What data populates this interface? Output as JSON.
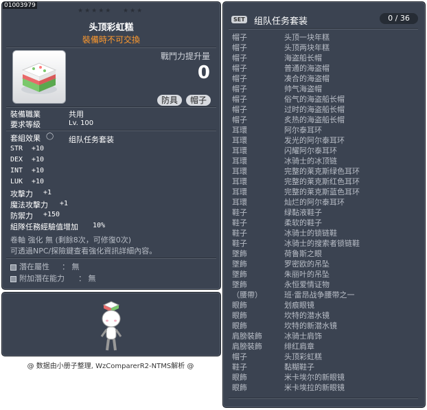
{
  "item": {
    "code": "01003979",
    "stars_left": "★★★★★",
    "stars_right": "★★★",
    "name": "头顶彩虹糕",
    "trade_note": "裝備時不可交換",
    "combat_label": "戰鬥力提升量",
    "combat_value": "0",
    "tags": [
      "防具",
      "帽子"
    ],
    "job_label": "裝備職業",
    "job_value": "共用",
    "level_label": "要求等級",
    "level_value": "Lv. 100",
    "set_effect_label": "套組效果",
    "set_effect_value": "组队任务套装",
    "stats": [
      {
        "name": "STR",
        "value": "+10"
      },
      {
        "name": "DEX",
        "value": "+10"
      },
      {
        "name": "INT",
        "value": "+10"
      },
      {
        "name": "LUK",
        "value": "+10"
      },
      {
        "name": "攻擊力",
        "value": "+1"
      },
      {
        "name": "魔法攻擊力",
        "value": "+1"
      },
      {
        "name": "防禦力",
        "value": "+150"
      },
      {
        "name": "組隊任務經驗值增加",
        "value": "10%"
      }
    ],
    "scroll_line": "卷軸 強化 無 (剩餘8次，可修復0次)",
    "hint_line": "可透過NPC/探險鍵查看強化資訊詳細內容。",
    "potential_label": "潛在屬性",
    "potential_value": "： 無",
    "bonus_potential_label": "附加潛在能力",
    "bonus_potential_value": "： 無"
  },
  "credit": "@ 数据由小册子整理, WzComparerR2-NTMS解析 @",
  "set": {
    "badge": "SET",
    "title": "组队任务套装",
    "counter": "0 / 36",
    "items": [
      {
        "cat": "帽子",
        "name": "头顶一块年糕"
      },
      {
        "cat": "帽子",
        "name": "头顶两块年糕"
      },
      {
        "cat": "帽子",
        "name": "海盗船长帽"
      },
      {
        "cat": "帽子",
        "name": "普通的海盗帽"
      },
      {
        "cat": "帽子",
        "name": "凑合的海盗帽"
      },
      {
        "cat": "帽子",
        "name": "帅气海盗帽"
      },
      {
        "cat": "帽子",
        "name": "俗气的海盗船长帽"
      },
      {
        "cat": "帽子",
        "name": "过时的海盗船长帽"
      },
      {
        "cat": "帽子",
        "name": "炙热的海盗船长帽"
      },
      {
        "cat": "耳環",
        "name": "阿尔泰耳环"
      },
      {
        "cat": "耳環",
        "name": "发光的阿尔泰耳环"
      },
      {
        "cat": "耳環",
        "name": "闪耀阿尔泰耳环"
      },
      {
        "cat": "耳環",
        "name": "冰骑士的冰顶链"
      },
      {
        "cat": "耳環",
        "name": "完整的莱克斯绿色耳环"
      },
      {
        "cat": "耳環",
        "name": "完整的莱克斯红色耳环"
      },
      {
        "cat": "耳環",
        "name": "完整的莱克斯蓝色耳环"
      },
      {
        "cat": "耳環",
        "name": "灿烂的阿尔泰耳环"
      },
      {
        "cat": "鞋子",
        "name": "绿黏液鞋子"
      },
      {
        "cat": "鞋子",
        "name": "柔软的鞋子"
      },
      {
        "cat": "鞋子",
        "name": "冰骑士的锁链鞋"
      },
      {
        "cat": "鞋子",
        "name": "冰骑士的搜索者锁链鞋"
      },
      {
        "cat": "墜飾",
        "name": "荷鲁斯之眼"
      },
      {
        "cat": "墜飾",
        "name": "罗密欧的吊坠"
      },
      {
        "cat": "墜飾",
        "name": "朱丽叶的吊坠"
      },
      {
        "cat": "墜飾",
        "name": "永恒爱情证物"
      },
      {
        "cat": "（腰帶）",
        "name": "班·雷昂战争腰带之一"
      },
      {
        "cat": "眼飾",
        "name": "划痕眼镜"
      },
      {
        "cat": "眼飾",
        "name": "坎特的潜水镜"
      },
      {
        "cat": "眼飾",
        "name": "坎特的新潜水镜"
      },
      {
        "cat": "肩膀裝飾",
        "name": "冰骑士肩饰"
      },
      {
        "cat": "肩膀裝飾",
        "name": "绯红肩章"
      },
      {
        "cat": "帽子",
        "name": "头顶彩虹糕"
      },
      {
        "cat": "鞋子",
        "name": "黏糊鞋子"
      },
      {
        "cat": "眼飾",
        "name": "米卡埃尔的新眼镜"
      },
      {
        "cat": "眼飾",
        "name": "米卡埃拉的新眼镜"
      }
    ]
  }
}
